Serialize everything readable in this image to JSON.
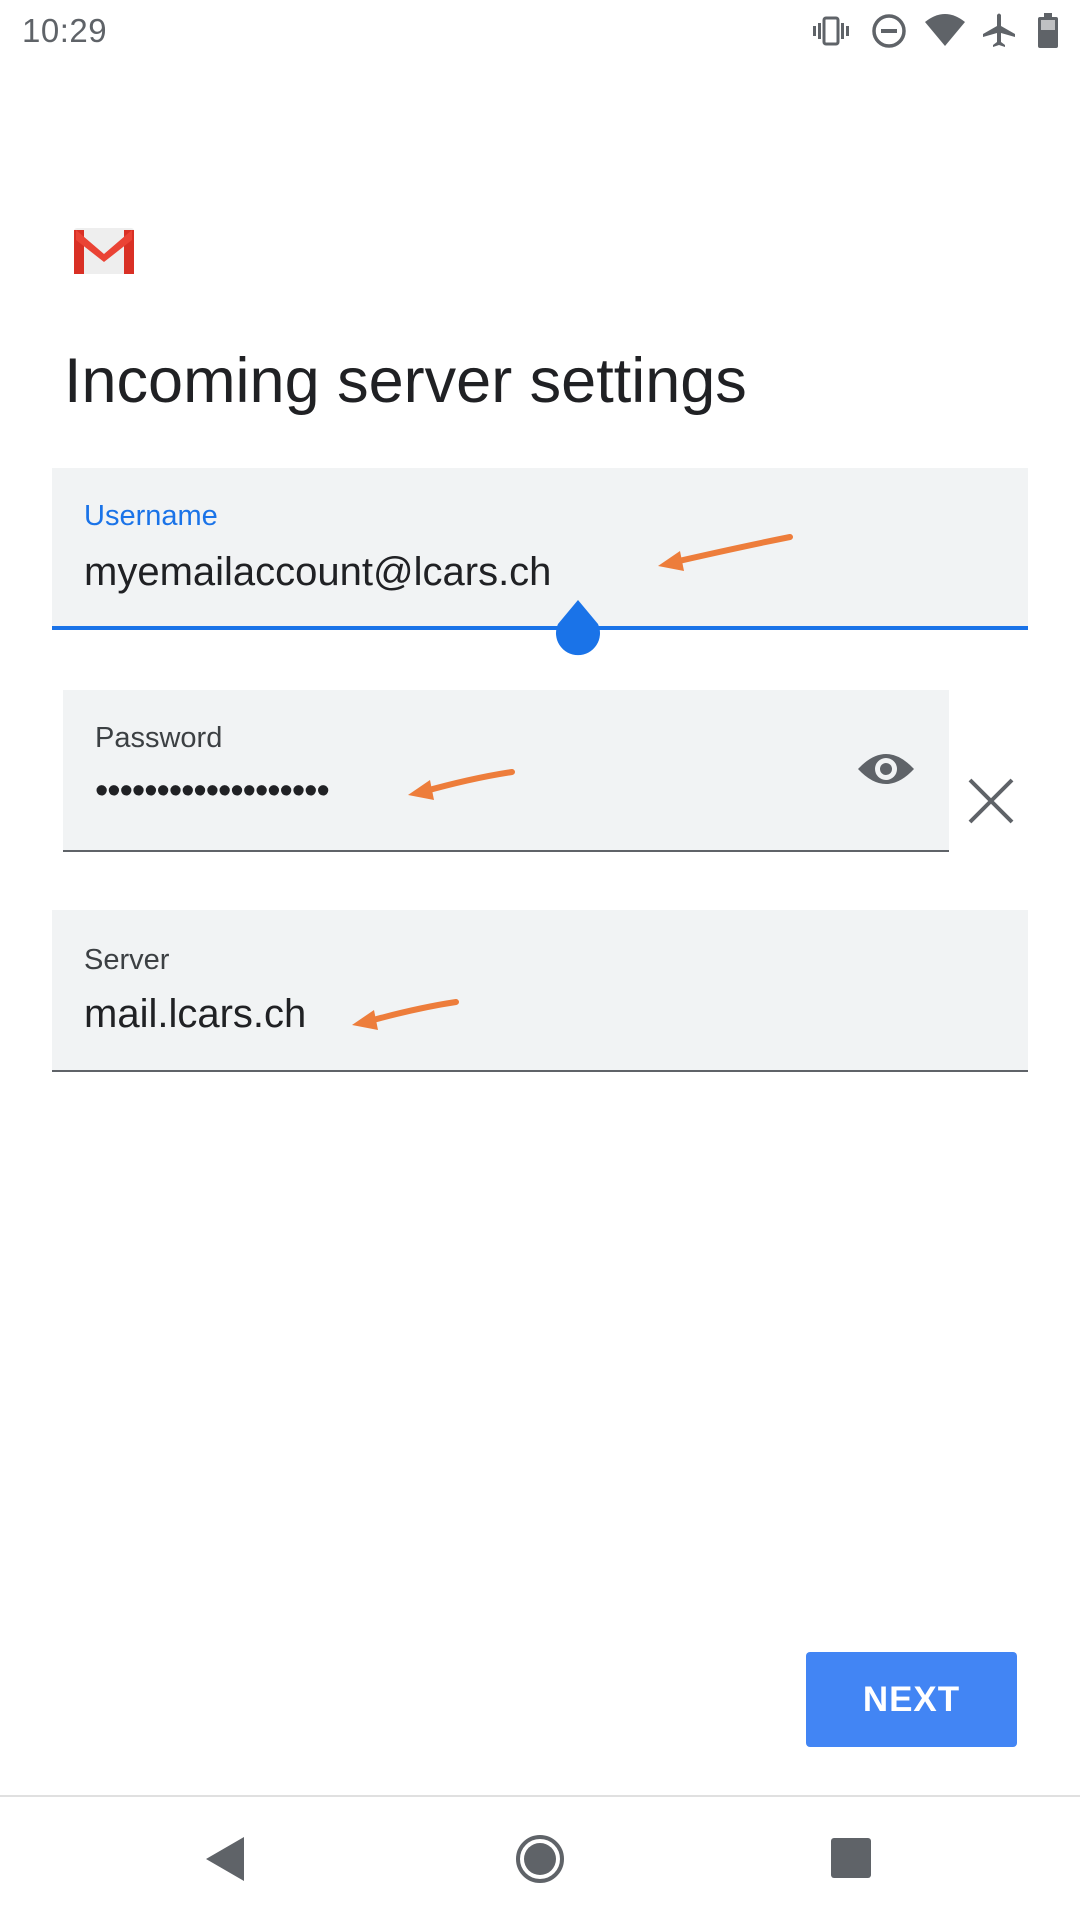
{
  "status_bar": {
    "time": "10:29",
    "icons": [
      "vibrate-icon",
      "do-not-disturb-icon",
      "wifi-icon",
      "airplane-icon",
      "battery-icon"
    ]
  },
  "app": {
    "logo": "gmail-logo"
  },
  "page": {
    "title": "Incoming server settings"
  },
  "form": {
    "username": {
      "label": "Username",
      "value": "myemailaccount@lcars.ch"
    },
    "password": {
      "label": "Password",
      "value": "•••••••••••••••••••"
    },
    "server": {
      "label": "Server",
      "value": "mail.lcars.ch"
    }
  },
  "actions": {
    "next_label": "NEXT"
  },
  "colors": {
    "accent": "#1a73e8",
    "button": "#4285f4",
    "annotation_arrow": "#ed7d3b",
    "field_bg": "#f1f3f4"
  },
  "nav_bar": {
    "icons": [
      "back-icon",
      "home-icon",
      "recents-icon"
    ]
  }
}
